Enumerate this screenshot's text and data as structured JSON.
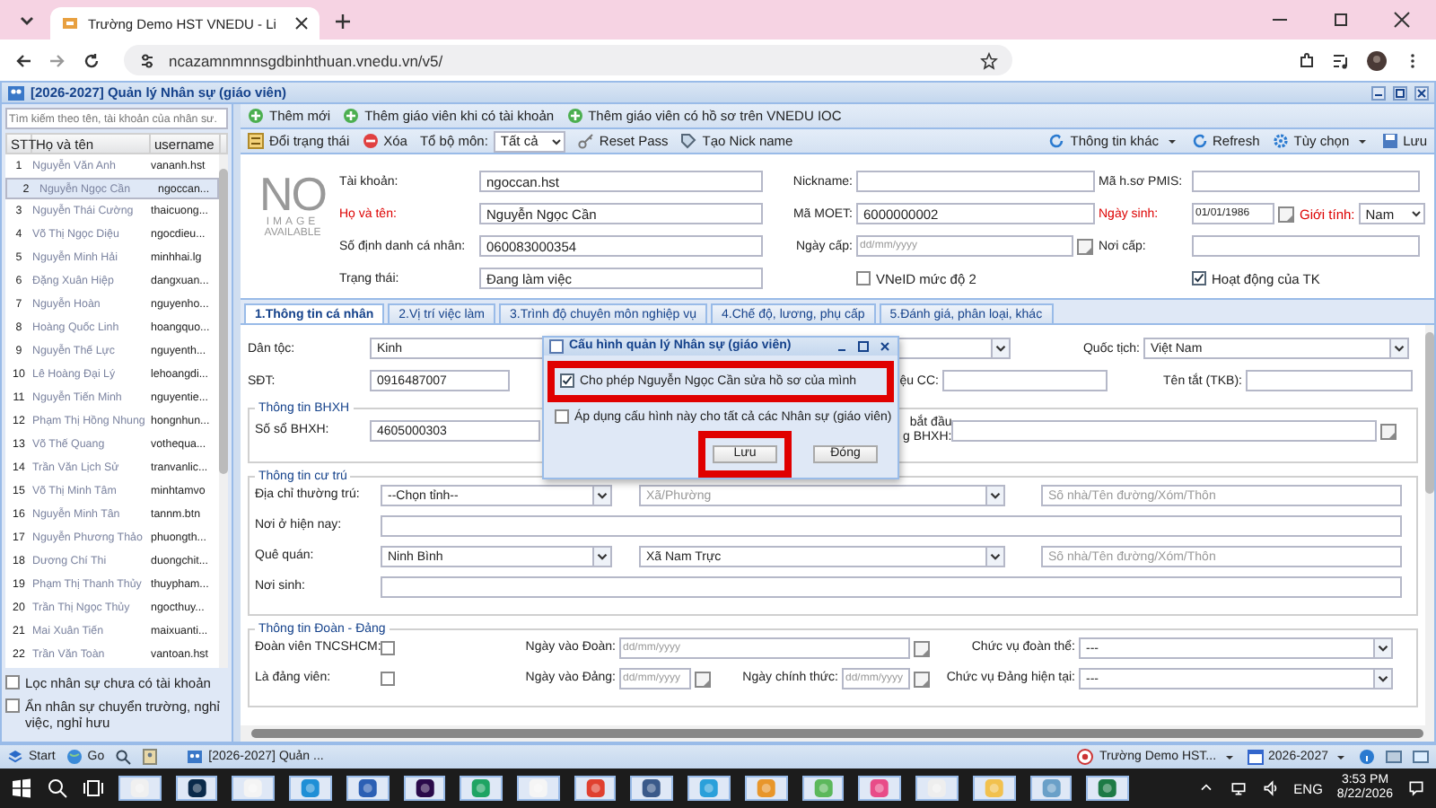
{
  "browser": {
    "tab_title": "Trường Demo HST VNEDU - Li",
    "address": "ncazamnmnnsgdbinhthuan.vnedu.vn/v5/"
  },
  "app": {
    "title": "[2026-2027] Quản lý Nhân sự (giáo viên)"
  },
  "staff_list": {
    "search_placeholder": "Tìm kiếm theo tên, tài khoản của nhân sư.",
    "columns": [
      "STT",
      "Họ và tên",
      "username"
    ],
    "rows": [
      {
        "stt": "1",
        "name": "Nguyễn Văn Anh",
        "username": "vananh.hst",
        "selected": false
      },
      {
        "stt": "2",
        "name": "Nguyễn Ngọc Cần",
        "username": "ngoccan...",
        "selected": true
      },
      {
        "stt": "3",
        "name": "Nguyễn Thái Cường",
        "username": "thaicuong...",
        "selected": false
      },
      {
        "stt": "4",
        "name": "Võ Thị Ngọc Diệu",
        "username": "ngocdieu...",
        "selected": false
      },
      {
        "stt": "5",
        "name": "Nguyễn Minh Hải",
        "username": "minhhai.lg",
        "selected": false
      },
      {
        "stt": "6",
        "name": "Đặng Xuân Hiệp",
        "username": "dangxuan...",
        "selected": false
      },
      {
        "stt": "7",
        "name": "Nguyễn Hoàn",
        "username": "nguyenho...",
        "selected": false
      },
      {
        "stt": "8",
        "name": "Hoàng Quốc Linh",
        "username": "hoangquo...",
        "selected": false
      },
      {
        "stt": "9",
        "name": "Nguyễn Thế Lực",
        "username": "nguyenth...",
        "selected": false
      },
      {
        "stt": "10",
        "name": "Lê Hoàng Đại Lý",
        "username": "lehoangdi...",
        "selected": false
      },
      {
        "stt": "11",
        "name": "Nguyễn Tiến Minh",
        "username": "nguyentie...",
        "selected": false
      },
      {
        "stt": "12",
        "name": "Phạm Thị Hồng Nhung",
        "username": "hongnhun...",
        "selected": false
      },
      {
        "stt": "13",
        "name": "Võ Thế Quang",
        "username": "vothequa...",
        "selected": false
      },
      {
        "stt": "14",
        "name": "Trần Văn Lịch Sử",
        "username": "tranvanlic...",
        "selected": false
      },
      {
        "stt": "15",
        "name": "Võ Thị Minh Tâm",
        "username": "minhtamvo",
        "selected": false
      },
      {
        "stt": "16",
        "name": "Nguyễn Minh Tân",
        "username": "tannm.btn",
        "selected": false
      },
      {
        "stt": "17",
        "name": "Nguyễn Phương Thảo",
        "username": "phuongth...",
        "selected": false
      },
      {
        "stt": "18",
        "name": "Dương Chí Thi",
        "username": "duongchit...",
        "selected": false
      },
      {
        "stt": "19",
        "name": "Phạm Thị Thanh Thủy",
        "username": "thuypham...",
        "selected": false
      },
      {
        "stt": "20",
        "name": "Trần Thị Ngọc Thủy",
        "username": "ngocthuy...",
        "selected": false
      },
      {
        "stt": "21",
        "name": "Mai Xuân Tiến",
        "username": "maixuanti...",
        "selected": false
      },
      {
        "stt": "22",
        "name": "Trần Văn Toàn",
        "username": "vantoan.hst",
        "selected": false
      }
    ],
    "filters": [
      {
        "label": "Lọc nhân sự chưa có tài khoản",
        "checked": false
      },
      {
        "label": "Ẩn nhân sự chuyển trường, nghỉ việc, nghỉ hưu",
        "checked": false
      }
    ]
  },
  "toolbar_1": [
    "Thêm mới",
    "Thêm giáo viên khi có tài khoản",
    "Thêm giáo viên có hồ sơ trên VNEDU IOC"
  ],
  "toolbar_2": {
    "left": [
      {
        "kind": "button",
        "label": "Đổi trạng thái"
      },
      {
        "kind": "button",
        "label": "Xóa"
      },
      {
        "kind": "select",
        "label": "Tổ bộ môn:",
        "value": "Tất cả"
      },
      {
        "kind": "button",
        "label": "Reset Pass"
      },
      {
        "kind": "button",
        "label": "Tạo Nick name"
      }
    ],
    "right": [
      {
        "kind": "menu",
        "label": "Thông tin khác"
      },
      {
        "kind": "button",
        "label": "Refresh"
      },
      {
        "kind": "menu",
        "label": "Tùy chọn"
      },
      {
        "kind": "button",
        "label": "Lưu"
      }
    ]
  },
  "profile": {
    "photo": {
      "line_1": "NO",
      "line_2": "IMAGE",
      "line_3": "AVAILABLE"
    },
    "rows": [
      {
        "cells": [
          {
            "kind": "text",
            "label": "Tài khoản:",
            "value": "ngoccan.hst",
            "required": false
          },
          {
            "kind": "text",
            "label": "Nickname:",
            "required": false
          },
          {
            "kind": "text",
            "label": "Mã h.sơ PMIS:",
            "required": false
          }
        ]
      },
      {
        "cells": [
          {
            "kind": "text",
            "label": "Họ và tên:",
            "value": "Nguyễn Ngọc Cần",
            "required": true
          },
          {
            "kind": "text",
            "label": "Mã MOET:",
            "value": "6000000002",
            "required": false
          },
          {
            "kind": "date",
            "label": "Ngày sinh:",
            "value": "01/01/1986",
            "required": true,
            "extra": {
              "label": "Giới tính:",
              "value": "Nam",
              "required": true
            }
          }
        ]
      },
      {
        "cells": [
          {
            "kind": "text",
            "label": "Số định danh cá nhân:",
            "value": "060083000354",
            "required": false
          },
          {
            "kind": "date",
            "label": "Ngày cấp:",
            "placeholder": "dd/mm/yyyy",
            "required": false
          },
          {
            "kind": "text",
            "label": "Nơi cấp:",
            "required": false
          }
        ]
      },
      {
        "cells": [
          {
            "kind": "text",
            "label": "Trạng thái:",
            "value": "Đang làm việc",
            "required": false
          },
          {
            "kind": "checkbox",
            "label": "VNeID mức độ 2",
            "checked": false
          },
          {
            "kind": "checkbox",
            "label": "Hoạt động của TK",
            "checked": true
          }
        ]
      }
    ]
  },
  "tabs": [
    {
      "label": "1.Thông tin cá nhân",
      "selected": true
    },
    {
      "label": "2.Vị trí việc làm",
      "selected": false
    },
    {
      "label": "3.Trình độ chuyên môn nghiệp vụ",
      "selected": false
    },
    {
      "label": "4.Chế độ, lương, phụ cấp",
      "selected": false
    },
    {
      "label": "5.Đánh giá, phân loại, khác",
      "selected": false
    }
  ],
  "personal_info": {
    "rows": [
      {
        "cells": [
          {
            "kind": "select",
            "label": "Dân tộc:",
            "value": "Kinh"
          },
          {
            "kind": "select",
            "label": "Quốc tịch:",
            "value": "Việt Nam"
          }
        ]
      },
      {
        "cells": [
          {
            "kind": "text",
            "label": "SĐT:",
            "value": "0916487007"
          },
          {
            "kind": "text",
            "label": "ệu CC:"
          },
          {
            "kind": "text",
            "label": "Tên tắt (TKB):"
          }
        ]
      }
    ],
    "sections": [
      {
        "title": "Thông tin BHXH",
        "rows": [
          {
            "cells": [
              {
                "kind": "text",
                "label": "Số sổ BHXH:",
                "value": "4605000303"
              },
              {
                "kind": "date",
                "label": "bắt đầu\ng BHXH:"
              }
            ]
          }
        ]
      },
      {
        "title": "Thông tin cư trú",
        "rows": [
          {
            "cells": [
              {
                "kind": "address",
                "label": "Địa chỉ thường trú:",
                "parts": [
                  {
                    "kind": "select",
                    "value": "--Chọn tỉnh--"
                  },
                  {
                    "kind": "select",
                    "placeholder": "Xã/Phường"
                  },
                  {
                    "kind": "text",
                    "placeholder": "Số nhà/Tên đường/Xóm/Thôn"
                  }
                ]
              }
            ]
          },
          {
            "cells": [
              {
                "kind": "text",
                "label": "Nơi ở hiện nay:"
              }
            ]
          },
          {
            "cells": [
              {
                "kind": "address",
                "label": "Quê quán:",
                "parts": [
                  {
                    "kind": "select",
                    "value": "Ninh Bình"
                  },
                  {
                    "kind": "select",
                    "value": "Xã Nam Trực"
                  },
                  {
                    "kind": "text",
                    "placeholder": "Số nhà/Tên đường/Xóm/Thôn"
                  }
                ]
              }
            ]
          },
          {
            "cells": [
              {
                "kind": "text",
                "label": "Nơi sinh:"
              }
            ]
          }
        ]
      },
      {
        "title": "Thông tin Đoàn - Đảng",
        "rows": [
          {
            "cells": [
              {
                "kind": "checkbox",
                "label": "Đoàn viên TNCSHCM:",
                "checked": false
              },
              {
                "kind": "date",
                "label": "Ngày vào Đoàn:",
                "placeholder": "dd/mm/yyyy"
              },
              {
                "kind": "blank"
              },
              {
                "kind": "select",
                "label": "Chức vụ đoàn thể:",
                "value": "---"
              }
            ]
          },
          {
            "cells": [
              {
                "kind": "checkbox",
                "label": "Là đảng viên:",
                "checked": false
              },
              {
                "kind": "date",
                "label": "Ngày vào Đảng:",
                "placeholder": "dd/mm/yyyy"
              },
              {
                "kind": "date",
                "label": "Ngày chính thức:",
                "placeholder": "dd/mm/yyyy"
              },
              {
                "kind": "select",
                "label": "Chức vụ Đảng hiện tại:",
                "value": "---"
              }
            ]
          }
        ]
      }
    ]
  },
  "dialog": {
    "title": "Cấu hình quản lý Nhân sự (giáo viên)",
    "options": [
      {
        "label": "Cho phép Nguyễn Ngọc Cần sửa hồ sơ của mình",
        "checked": true,
        "highlighted": true
      },
      {
        "label": "Áp dụng cấu hình này cho tất cả các Nhân sự (giáo viên)",
        "checked": false,
        "highlighted": false
      }
    ],
    "buttons": [
      {
        "label": "Lưu",
        "highlighted": true
      },
      {
        "label": "Đóng",
        "highlighted": false
      }
    ]
  },
  "app_bar": {
    "left": [
      "Start",
      "Go"
    ],
    "window": "[2026-2027] Quản ...",
    "right": [
      "Trường Demo HST...",
      "2026-2027"
    ]
  },
  "taskbar": {
    "language": "ENG",
    "time": "3:53 PM",
    "date": "8/22/2026"
  }
}
